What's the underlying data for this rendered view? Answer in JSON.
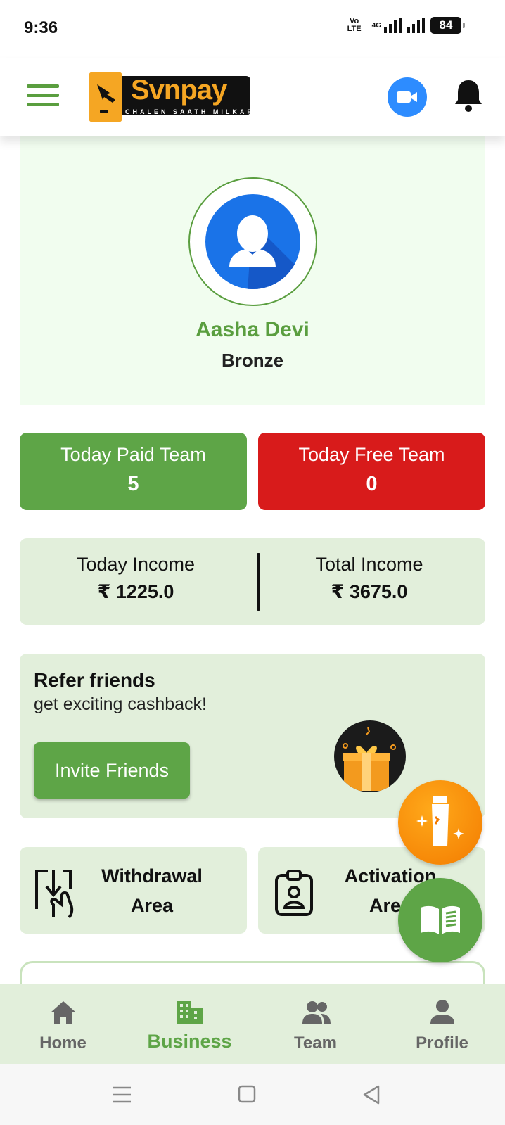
{
  "status": {
    "time": "9:36",
    "volte_top": "Vo",
    "volte_bottom": "LTE",
    "network": "4G",
    "battery": "84"
  },
  "header": {
    "logo_text": "Svnpay",
    "logo_tagline": "CHALEN SAATH MILKAR",
    "menu_icon": "hamburger-icon",
    "video_icon": "video-camera-icon",
    "bell_icon": "bell-icon"
  },
  "profile": {
    "name": "Aasha Devi",
    "rank": "Bronze"
  },
  "team": {
    "paid_label": "Today Paid Team",
    "paid_value": "5",
    "free_label": "Today Free Team",
    "free_value": "0"
  },
  "income": {
    "today_label": "Today Income",
    "today_value": "₹ 1225.0",
    "total_label": "Total Income",
    "total_value": "₹ 3675.0"
  },
  "refer": {
    "title": "Refer friends",
    "subtitle": "get exciting cashback!",
    "button": "Invite Friends"
  },
  "areas": {
    "withdrawal_line1": "Withdrawal",
    "withdrawal_line2": "Area",
    "activation_line1": "Activation",
    "activation_line2": "Area"
  },
  "nav": [
    {
      "label": "Home",
      "icon": "home-icon"
    },
    {
      "label": "Business",
      "icon": "business-icon"
    },
    {
      "label": "Team",
      "icon": "team-icon"
    },
    {
      "label": "Profile",
      "icon": "profile-icon"
    }
  ],
  "colors": {
    "green": "#5ea547",
    "red": "#d81b1b",
    "light_green": "#e2efdb",
    "blue": "#2d8cff",
    "orange": "#f5a623"
  }
}
